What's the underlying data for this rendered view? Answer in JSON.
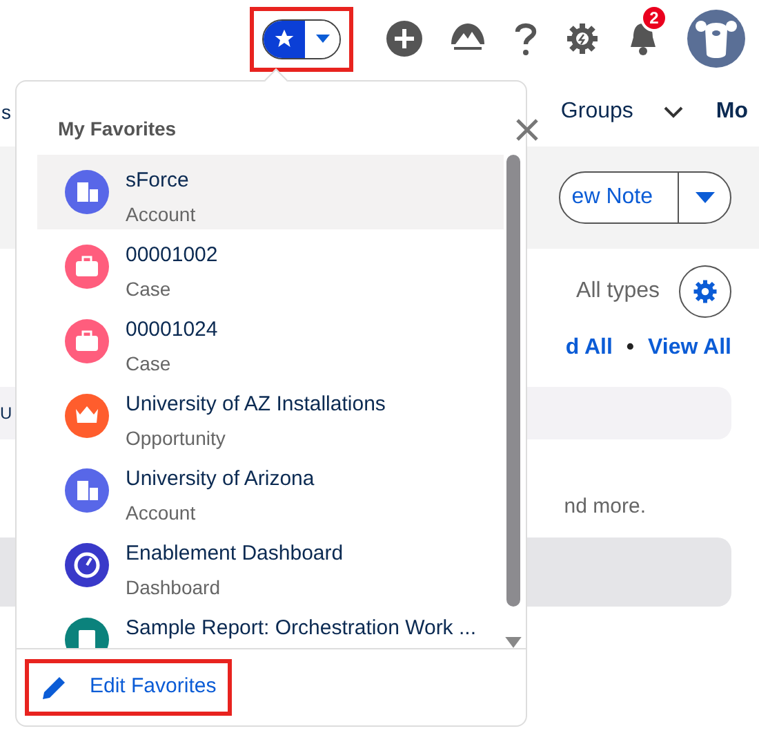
{
  "header": {
    "notification_count": "2"
  },
  "background": {
    "nav_left": "s",
    "nav_groups": "Groups",
    "nav_more": "Mo",
    "new_note": "ew Note",
    "filter": "All types",
    "link_partial": "d All",
    "separator": "•",
    "link_view_all": "View All",
    "row_partial": "U",
    "hint_partial": "nd more."
  },
  "favorites": {
    "title": "My Favorites",
    "items": [
      {
        "name": "sForce",
        "type": "Account",
        "kind": "account",
        "color": "#5867e8",
        "selected": true
      },
      {
        "name": "00001002",
        "type": "Case",
        "kind": "case",
        "color": "#ff5d7d",
        "selected": false
      },
      {
        "name": "00001024",
        "type": "Case",
        "kind": "case",
        "color": "#ff5d7d",
        "selected": false
      },
      {
        "name": "University of AZ Installations",
        "type": "Opportunity",
        "kind": "opportunity",
        "color": "#ff5d2d",
        "selected": false
      },
      {
        "name": "University of Arizona",
        "type": "Account",
        "kind": "account",
        "color": "#5867e8",
        "selected": false
      },
      {
        "name": "Enablement Dashboard",
        "type": "Dashboard",
        "kind": "dashboard",
        "color": "#3939c9",
        "selected": false
      },
      {
        "name": "Sample Report: Orchestration Work ...",
        "kind": "report",
        "color": "#0b827c",
        "selected": false
      }
    ],
    "edit": "Edit Favorites"
  }
}
